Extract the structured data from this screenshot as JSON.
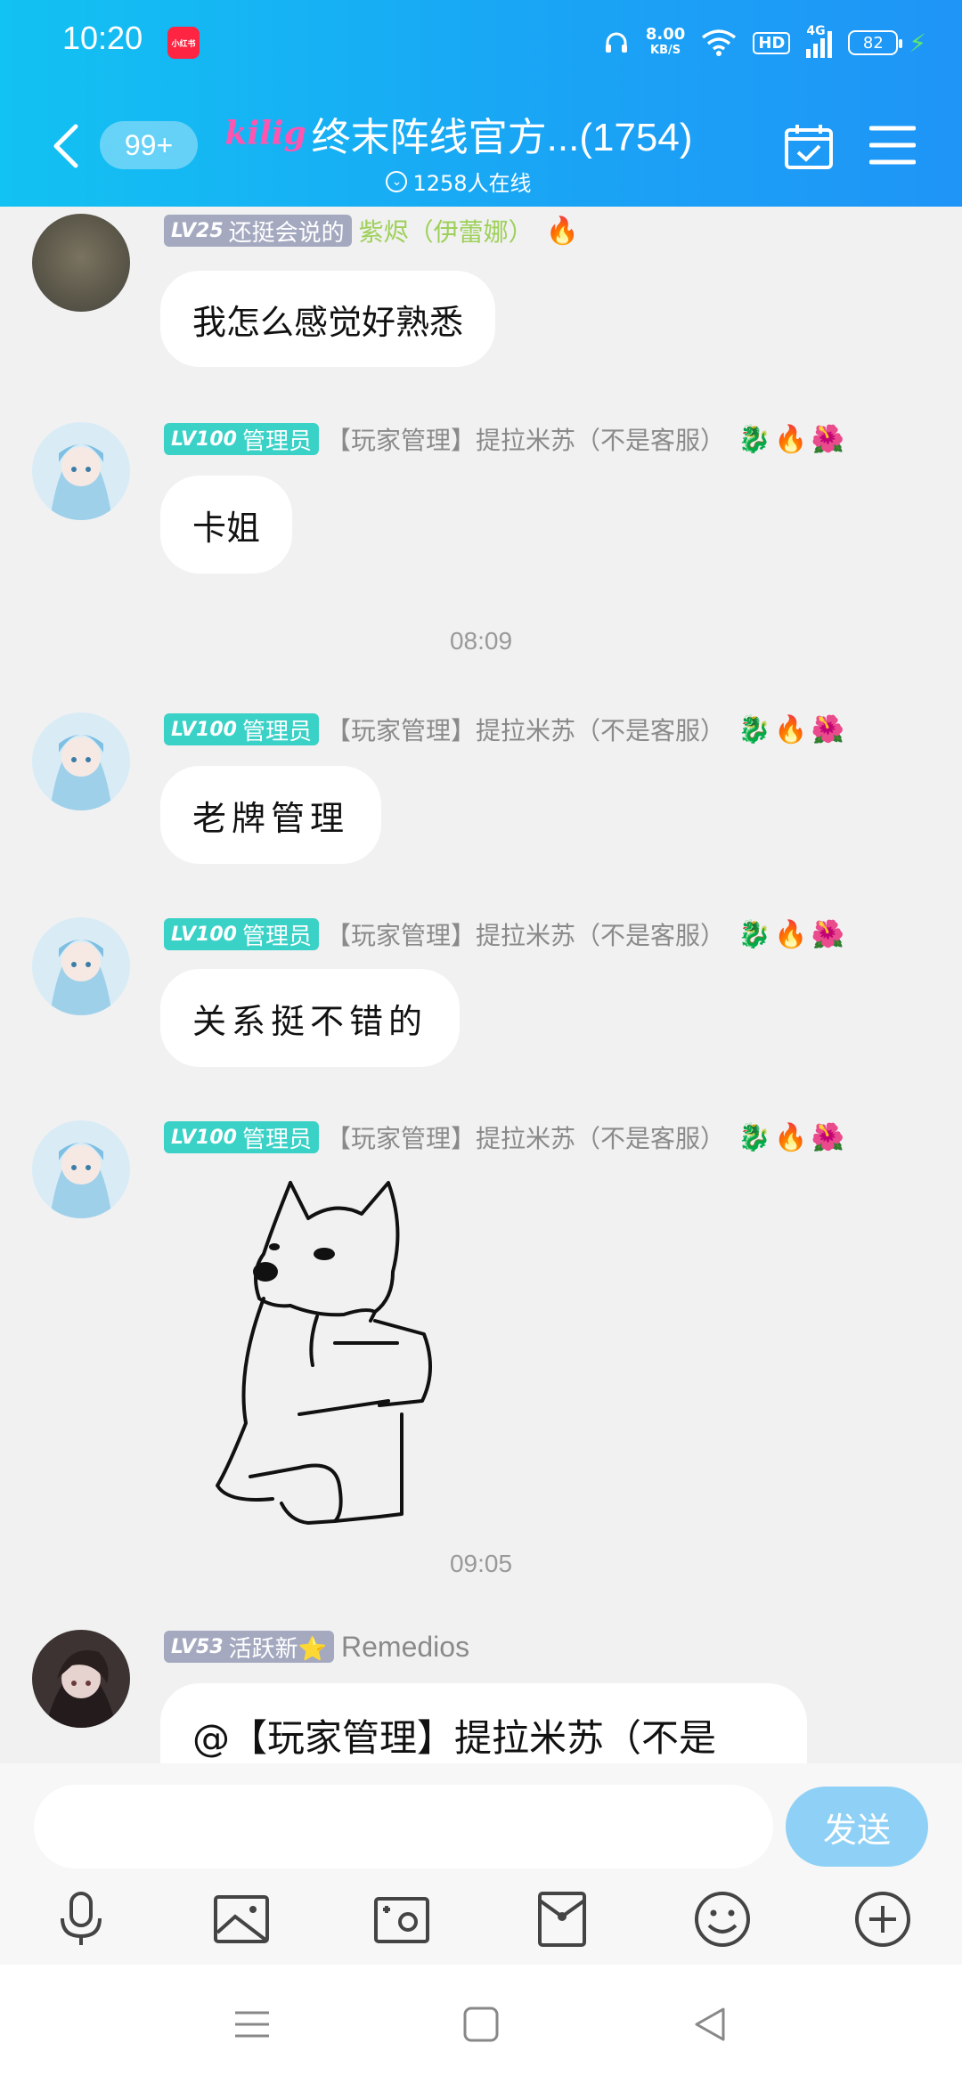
{
  "status_bar": {
    "time": "10:20",
    "app_badge": "小红书",
    "net_speed": "8.00",
    "net_unit": "KB/S",
    "hd": "HD",
    "signal": "4G",
    "battery": "82"
  },
  "header": {
    "unread_count": "99+",
    "logo_text": "kilig",
    "title": "终末阵线官方...(1754)",
    "online_text": "1258人在线"
  },
  "messages": [
    {
      "level": "LV25",
      "badge": "还挺会说的",
      "name": "紫烬（伊蕾娜）",
      "text": "我怎么感觉好熟悉"
    },
    {
      "level": "LV100",
      "badge": "管理员",
      "name": "【玩家管理】提拉米苏（不是客服）",
      "text": "卡姐"
    },
    {
      "level": "LV100",
      "badge": "管理员",
      "name": "【玩家管理】提拉米苏（不是客服）",
      "text": "老牌管理"
    },
    {
      "level": "LV100",
      "badge": "管理员",
      "name": "【玩家管理】提拉米苏（不是客服）",
      "text": "关系挺不错的"
    },
    {
      "level": "LV100",
      "badge": "管理员",
      "name": "【玩家管理】提拉米苏（不是客服）"
    },
    {
      "level": "LV53",
      "badge": "活跃新⭐",
      "name": "Remedios",
      "text": "@【玩家管理】提拉米苏（不是"
    }
  ],
  "timestamps": [
    "08:09",
    "09:05"
  ],
  "input": {
    "placeholder": "",
    "send_label": "发送"
  },
  "toolbar_icons": [
    "microphone-icon",
    "image-icon",
    "camera-icon",
    "red-packet-icon",
    "emoji-icon",
    "plus-icon"
  ],
  "colors": {
    "header_start": "#12c2f2",
    "header_end": "#1f95f7",
    "admin_tag": "#3ad1c7",
    "level_tag": "#a4a9c0",
    "send_button": "#8fd1f6"
  }
}
